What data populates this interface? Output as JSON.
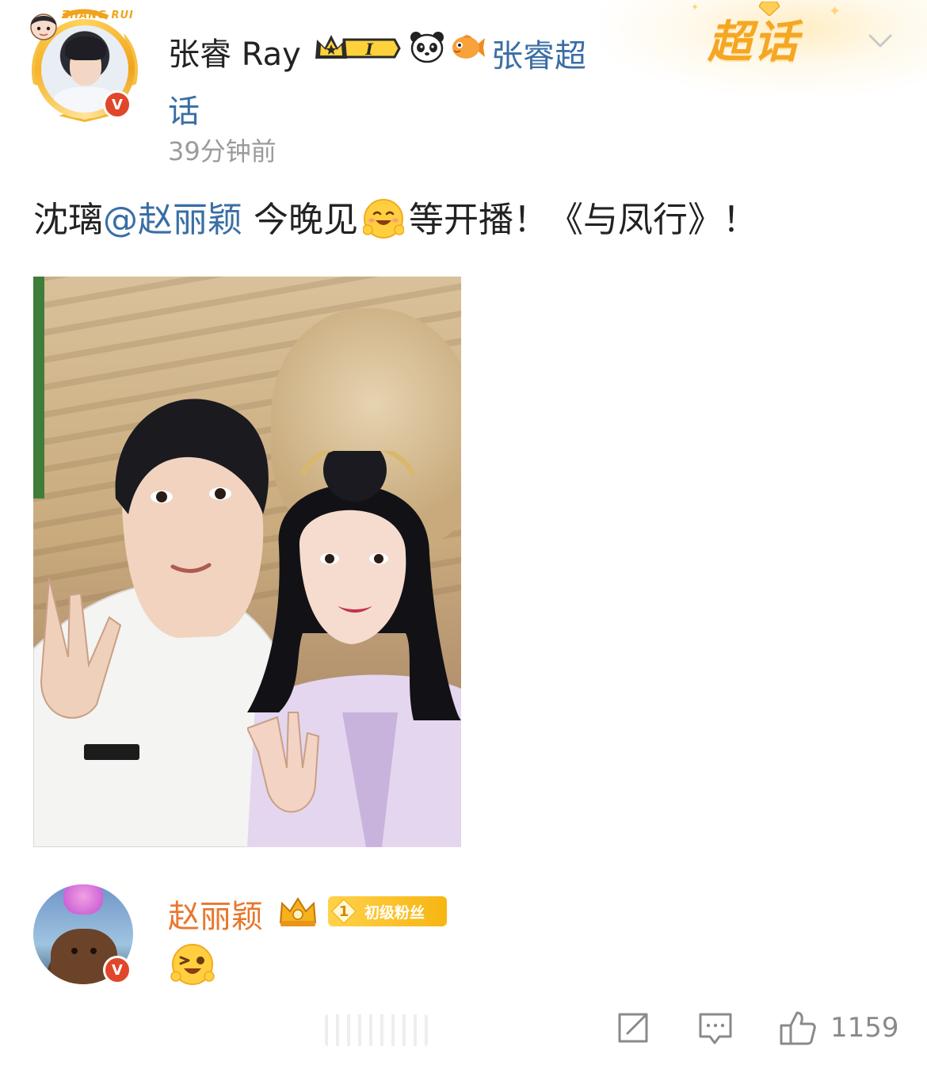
{
  "header": {
    "username": "张睿 Ray",
    "crown_level": "I",
    "supertopic_link": "张睿超话",
    "timestamp": "39分钟前",
    "chaohua_label": "超话",
    "avatar_chibi_text": "ZHANG RUI",
    "verified_mark": "V"
  },
  "post": {
    "text_lead": "沈璃",
    "mention": "@赵丽颖",
    "text_mid": " 今晚见",
    "text_tail": "等开播！《与凤行》！"
  },
  "comment": {
    "commenter_name": "赵丽颖",
    "fan_level": "1",
    "fan_badge_text": "初级粉丝",
    "verified_mark": "V"
  },
  "actions": {
    "like_count": "1159"
  },
  "colors": {
    "link_blue": "#3a6ea5",
    "commenter_orange": "#e8772e",
    "verified_red": "#e0472a",
    "chaohua_gold": "#f5a623",
    "timestamp_gray": "#9b9b9b"
  },
  "icons": [
    "chevron-down-icon",
    "crown-icon",
    "panda-icon",
    "fish-icon",
    "smile-emoji-icon",
    "wink-emoji-icon",
    "share-icon",
    "comment-icon",
    "like-icon"
  ]
}
